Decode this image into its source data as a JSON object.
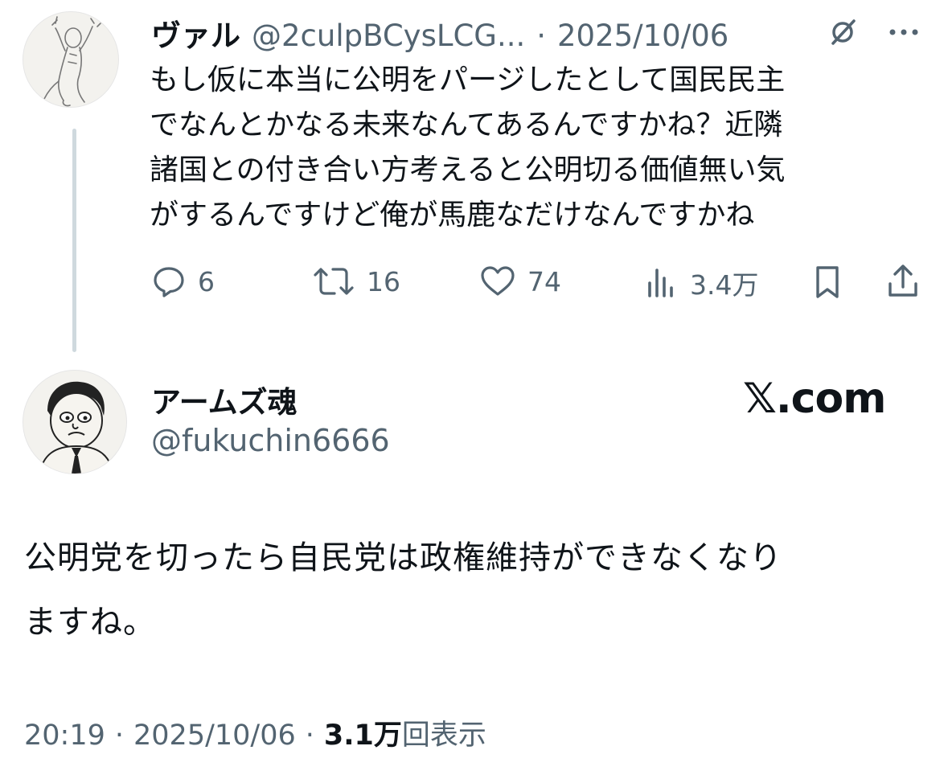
{
  "reply_tweet": {
    "display_name": "ヴァル",
    "handle": "@2culpBCysLCG...",
    "separator": "·",
    "date": "2025/10/06",
    "text_lines": [
      "もし仮に本当に公明をパージしたとして国民民主",
      "でなんとかなる未来なんてあるんですかね？近隣",
      "諸国との付き合い方考えると公明切る価値無い気",
      "がするんですけど俺が馬鹿なだけなんですかね"
    ],
    "metrics": {
      "replies": "6",
      "reposts": "16",
      "likes": "74",
      "views": "3.4万"
    },
    "icons": [
      "grok-icon",
      "more-icon",
      "reply-icon",
      "repost-icon",
      "like-icon",
      "views-icon",
      "bookmark-icon",
      "share-icon"
    ]
  },
  "main_tweet": {
    "display_name": "アームズ魂",
    "handle": "@fukuchin6666",
    "brand": "𝕏.com",
    "text_lines": [
      "公明党を切ったら自民党は政権維持ができなくなり",
      "ますね。"
    ],
    "time": "20:19",
    "separator": "·",
    "date": "2025/10/06",
    "views_count": "3.1万",
    "views_label": "回表示"
  },
  "colors": {
    "text": "#0f1419",
    "secondary": "#536471",
    "thread_line": "#cfd9de"
  }
}
